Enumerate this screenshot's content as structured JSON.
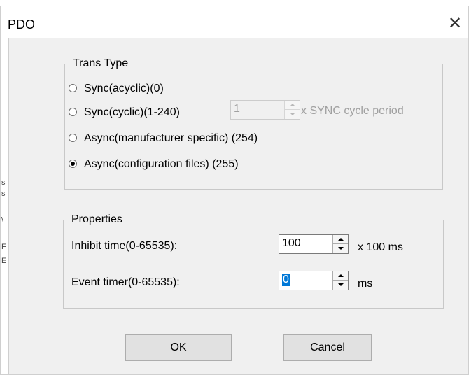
{
  "window": {
    "title": "PDO",
    "close_glyph": "✕"
  },
  "trans_type": {
    "legend": "Trans Type",
    "options": [
      {
        "label": "Sync(acyclic)(0)",
        "checked": false
      },
      {
        "label": "Sync(cyclic)(1-240)",
        "checked": false
      },
      {
        "label": "Async(manufacturer specific) (254)",
        "checked": false
      },
      {
        "label": "Async(configuration files) (255)",
        "checked": true
      }
    ],
    "sync_cycle": {
      "value": "1",
      "suffix": "x SYNC cycle period",
      "enabled": false
    }
  },
  "properties": {
    "legend": "Properties",
    "inhibit_time": {
      "label": "Inhibit time(0-65535):",
      "value": "100",
      "unit": "x 100 ms"
    },
    "event_timer": {
      "label": "Event timer(0-65535):",
      "value": "0",
      "unit": "ms"
    }
  },
  "buttons": {
    "ok": "OK",
    "cancel": "Cancel"
  },
  "colors": {
    "dialog_bg": "#f0f0f0",
    "selection": "#0078d7"
  }
}
